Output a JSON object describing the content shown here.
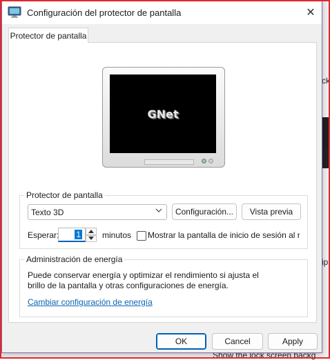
{
  "dialog": {
    "title": "Configuración del protector de pantalla",
    "close_glyph": "✕",
    "tab_label": "Protector de pantalla"
  },
  "preview": {
    "text": "GNet"
  },
  "screensaver_group": {
    "title": "Protector de pantalla",
    "selected": "Texto 3D",
    "settings_button": "Configuración...",
    "preview_button": "Vista previa",
    "wait_label": "Esperar:",
    "wait_value": "1",
    "minutes_label": "minutos",
    "logon_checkbox_label": "Mostrar la pantalla de inicio de sesión al re"
  },
  "power_group": {
    "title": "Administración de energía",
    "description_line1": "Puede conservar energía y optimizar el rendimiento si ajusta el",
    "description_line2": "brillo de la pantalla y otras configuraciones de energía.",
    "link": "Cambiar configuración de energía"
  },
  "footer": {
    "ok": "OK",
    "cancel": "Cancel",
    "apply": "Apply"
  },
  "background": {
    "frag_right_1": "ck",
    "frag_right_2": "ip",
    "frag_bottom": "Show the lock screen backg"
  },
  "colors": {
    "accent": "#005fb8",
    "link": "#0a64b4",
    "frame": "#e3262b"
  }
}
